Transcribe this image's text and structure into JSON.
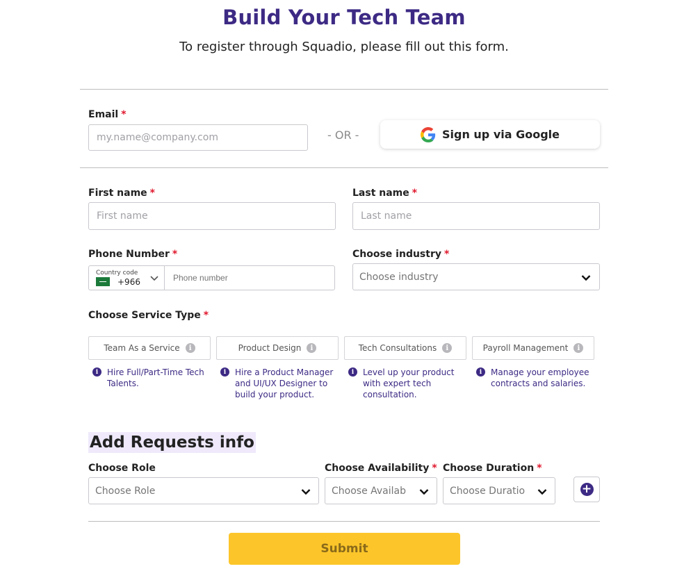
{
  "header": {
    "title": "Build Your Tech Team",
    "subtitle": "To register through Squadio, please fill out this form."
  },
  "email": {
    "label": "Email",
    "required_mark": "*",
    "placeholder": "my.name@company.com"
  },
  "or_text": "- OR -",
  "google": {
    "label": "Sign up via Google",
    "icon": "google-icon"
  },
  "first_name": {
    "label": "First name",
    "required_mark": "*",
    "placeholder": "First name"
  },
  "last_name": {
    "label": "Last name",
    "required_mark": "*",
    "placeholder": "Last name"
  },
  "phone": {
    "label": "Phone Number",
    "required_mark": "*",
    "country_code_label": "Country code",
    "dial_code": "+966",
    "flag_icon": "saudi-flag-icon",
    "placeholder": "Phone number"
  },
  "industry": {
    "label": "Choose industry",
    "required_mark": "*",
    "selected": "Choose industry"
  },
  "service": {
    "label": "Choose Service Type",
    "required_mark": "*",
    "types": [
      {
        "name": "Team As a Service",
        "description": "Hire Full/Part-Time Tech Talents."
      },
      {
        "name": "Product Design",
        "description": "Hire a Product Manager and UI/UX Designer to build your product."
      },
      {
        "name": "Tech Consultations",
        "description": "Level up your product with expert tech consultation."
      },
      {
        "name": "Payroll Management",
        "description": "Manage your employee contracts and salaries."
      }
    ]
  },
  "requests": {
    "title": "Add Requests info",
    "role": {
      "label": "Choose Role",
      "selected": "Choose Role"
    },
    "availability": {
      "label": "Choose Availability",
      "required_mark": "*",
      "selected": "Choose Availab"
    },
    "duration": {
      "label": "Choose Duration",
      "required_mark": "*",
      "selected": "Choose Duratio"
    },
    "add_icon": "plus-icon"
  },
  "submit_label": "Submit",
  "colors": {
    "brand_purple": "#3d2a84",
    "required_red": "#e0182d",
    "submit_yellow": "#fcc62a",
    "section_highlight": "#efe9fb"
  }
}
